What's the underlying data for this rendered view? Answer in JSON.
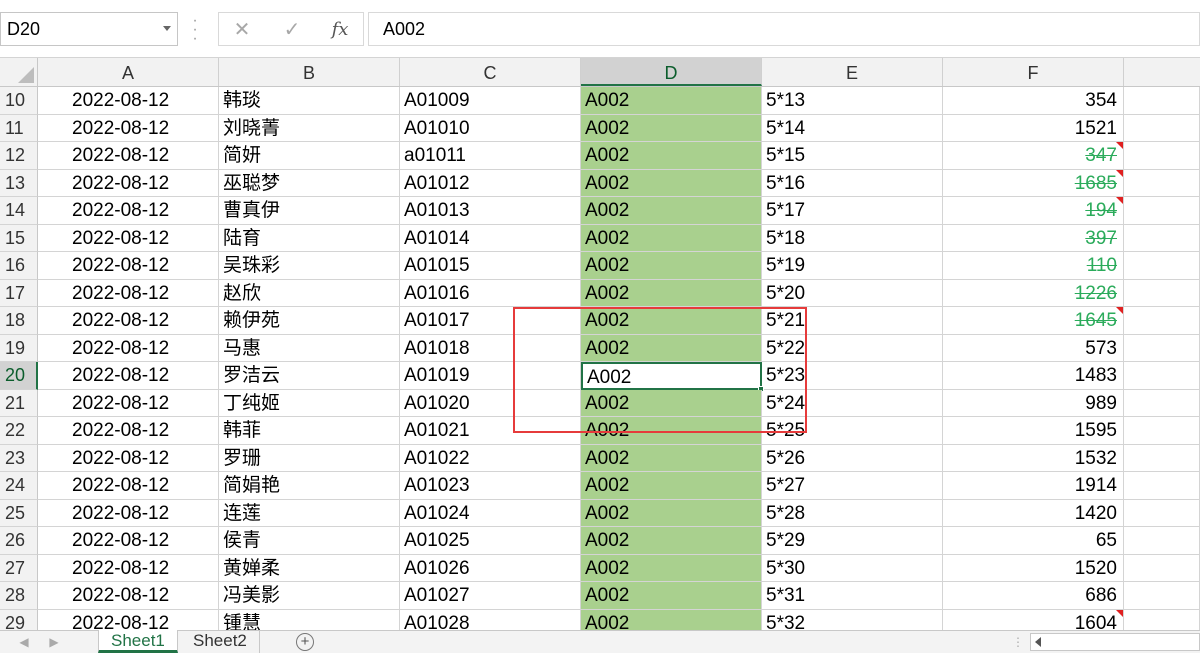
{
  "formula_bar": {
    "name_box": "D20",
    "cancel_icon": "✕",
    "enter_icon": "✓",
    "fx_label": "fx",
    "formula": "A002"
  },
  "columns": [
    "A",
    "B",
    "C",
    "D",
    "E",
    "F"
  ],
  "selected_column": "D",
  "active_cell": "D20",
  "rows": [
    {
      "num": "10",
      "a": "2022-08-12",
      "b": "韩琰",
      "c": "A01009",
      "d": "A002",
      "e": "5*13",
      "f": "354",
      "struck": false,
      "comment": false
    },
    {
      "num": "11",
      "a": "2022-08-12",
      "b": "刘晓菁",
      "c": "A01010",
      "d": "A002",
      "e": "5*14",
      "f": "1521",
      "struck": false,
      "comment": false
    },
    {
      "num": "12",
      "a": "2022-08-12",
      "b": "简妍",
      "c": "a01011",
      "d": "A002",
      "e": "5*15",
      "f": "347",
      "struck": true,
      "comment": true
    },
    {
      "num": "13",
      "a": "2022-08-12",
      "b": "巫聪梦",
      "c": "A01012",
      "d": "A002",
      "e": "5*16",
      "f": "1685",
      "struck": true,
      "comment": true
    },
    {
      "num": "14",
      "a": "2022-08-12",
      "b": "曹真伊",
      "c": "A01013",
      "d": "A002",
      "e": "5*17",
      "f": "194",
      "struck": true,
      "comment": true
    },
    {
      "num": "15",
      "a": "2022-08-12",
      "b": "陆育",
      "c": "A01014",
      "d": "A002",
      "e": "5*18",
      "f": "397",
      "struck": true,
      "comment": false
    },
    {
      "num": "16",
      "a": "2022-08-12",
      "b": "吴珠彩",
      "c": "A01015",
      "d": "A002",
      "e": "5*19",
      "f": "110",
      "struck": true,
      "comment": false
    },
    {
      "num": "17",
      "a": "2022-08-12",
      "b": "赵欣",
      "c": "A01016",
      "d": "A002",
      "e": "5*20",
      "f": "1226",
      "struck": true,
      "comment": false
    },
    {
      "num": "18",
      "a": "2022-08-12",
      "b": "赖伊苑",
      "c": "A01017",
      "d": "A002",
      "e": "5*21",
      "f": "1645",
      "struck": true,
      "comment": true
    },
    {
      "num": "19",
      "a": "2022-08-12",
      "b": "马惠",
      "c": "A01018",
      "d": "A002",
      "e": "5*22",
      "f": "573",
      "struck": false,
      "comment": false
    },
    {
      "num": "20",
      "a": "2022-08-12",
      "b": "罗洁云",
      "c": "A01019",
      "d": "A002",
      "e": "5*23",
      "f": "1483",
      "struck": false,
      "comment": false
    },
    {
      "num": "21",
      "a": "2022-08-12",
      "b": "丁纯姬",
      "c": "A01020",
      "d": "A002",
      "e": "5*24",
      "f": "989",
      "struck": false,
      "comment": false
    },
    {
      "num": "22",
      "a": "2022-08-12",
      "b": "韩菲",
      "c": "A01021",
      "d": "A002",
      "e": "5*25",
      "f": "1595",
      "struck": false,
      "comment": false
    },
    {
      "num": "23",
      "a": "2022-08-12",
      "b": "罗珊",
      "c": "A01022",
      "d": "A002",
      "e": "5*26",
      "f": "1532",
      "struck": false,
      "comment": false
    },
    {
      "num": "24",
      "a": "2022-08-12",
      "b": "简娟艳",
      "c": "A01023",
      "d": "A002",
      "e": "5*27",
      "f": "1914",
      "struck": false,
      "comment": false
    },
    {
      "num": "25",
      "a": "2022-08-12",
      "b": "连莲",
      "c": "A01024",
      "d": "A002",
      "e": "5*28",
      "f": "1420",
      "struck": false,
      "comment": false
    },
    {
      "num": "26",
      "a": "2022-08-12",
      "b": "侯青",
      "c": "A01025",
      "d": "A002",
      "e": "5*29",
      "f": "65",
      "struck": false,
      "comment": false
    },
    {
      "num": "27",
      "a": "2022-08-12",
      "b": "黄婵柔",
      "c": "A01026",
      "d": "A002",
      "e": "5*30",
      "f": "1520",
      "struck": false,
      "comment": false
    },
    {
      "num": "28",
      "a": "2022-08-12",
      "b": "冯美影",
      "c": "A01027",
      "d": "A002",
      "e": "5*31",
      "f": "686",
      "struck": false,
      "comment": false
    },
    {
      "num": "29",
      "a": "2022-08-12",
      "b": "锺慧",
      "c": "A01028",
      "d": "A002",
      "e": "5*32",
      "f": "1604",
      "struck": false,
      "comment": true
    }
  ],
  "sheet_tabs": [
    {
      "label": "Sheet1",
      "active": true
    },
    {
      "label": "Sheet2",
      "active": false
    }
  ],
  "add_sheet_icon": "+",
  "colors": {
    "accent": "#217346",
    "column_fill": "#a9d08e",
    "strike_text": "#2bab5b",
    "comment_marker": "#e02020",
    "annotation": "#e63b3b"
  }
}
